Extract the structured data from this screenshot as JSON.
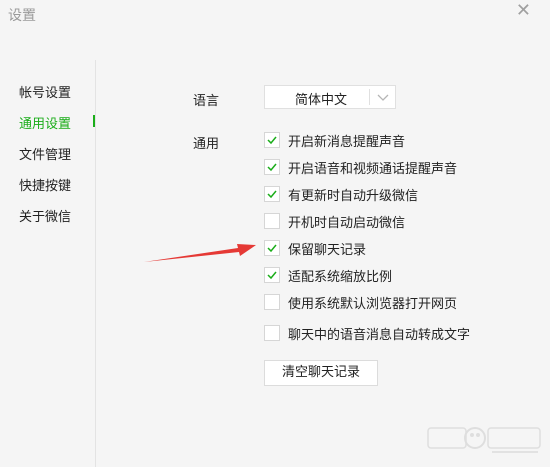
{
  "window": {
    "title": "设置",
    "close_symbol": "✕"
  },
  "sidebar": {
    "items": [
      {
        "label": "帐号设置"
      },
      {
        "label": "通用设置",
        "active": true
      },
      {
        "label": "文件管理"
      },
      {
        "label": "快捷按键"
      },
      {
        "label": "关于微信"
      }
    ]
  },
  "general": {
    "language_label": "语言",
    "language_value": "简体中文",
    "section_label": "通用",
    "options": [
      {
        "label": "开启新消息提醒声音",
        "checked": true
      },
      {
        "label": "开启语音和视频通话提醒声音",
        "checked": true
      },
      {
        "label": "有更新时自动升级微信",
        "checked": true
      },
      {
        "label": "开机时自动启动微信",
        "checked": false
      },
      {
        "label": "保留聊天记录",
        "checked": true
      },
      {
        "label": "适配系统缩放比例",
        "checked": true
      },
      {
        "label": "使用系统默认浏览器打开网页",
        "checked": false
      },
      {
        "label": "聊天中的语音消息自动转成文字",
        "checked": false
      }
    ],
    "clear_button": "清空聊天记录"
  },
  "colors": {
    "accent": "#1aad19",
    "annotation_arrow": "#e53935"
  }
}
